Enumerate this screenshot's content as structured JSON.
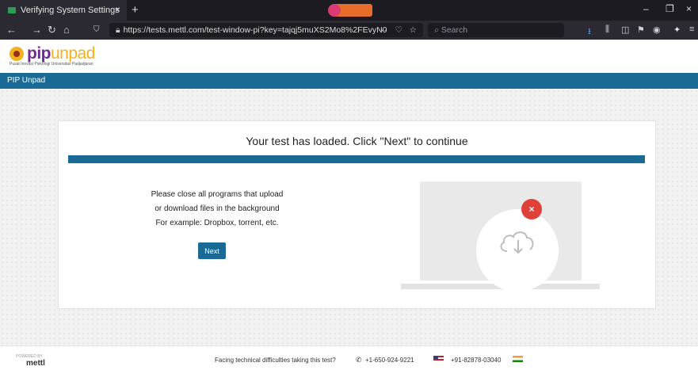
{
  "browser": {
    "tab_title": "Verifying System Settings",
    "tab_close": "×",
    "new_tab": "+",
    "url": "https://tests.mettl.com/test-window-pi?key=tajqj5muXS2Mo8%2FEvyN0",
    "url_menu": "···",
    "search_placeholder": "Search",
    "window_controls": {
      "minimize": "–",
      "restore": "❐",
      "close": "×"
    }
  },
  "site": {
    "brand_left": "pip",
    "brand_right": "unpad",
    "brand_sub": "Pusat Inovasi Psikologi Universitas Padjadjaran",
    "nav_bar": "PIP Unpad"
  },
  "card": {
    "title": "Your test has loaded. Click \"Next\" to continue",
    "instructions": [
      "Please close all programs that upload",
      "or download files in the background",
      "For example: Dropbox, torrent, etc."
    ],
    "next_label": "Next",
    "error_icon": "×"
  },
  "footer": {
    "powered": "POWERED BY",
    "mettl": "mettl",
    "help_text": "Facing technical difficulties taking this test?",
    "phone_us": "+1-650-924-9221",
    "phone_in": "+91-82878-03040"
  },
  "colors": {
    "primary": "#1b6a95",
    "error": "#e0403a",
    "brand_purple": "#6f2a91",
    "brand_yellow": "#f2b21f"
  }
}
